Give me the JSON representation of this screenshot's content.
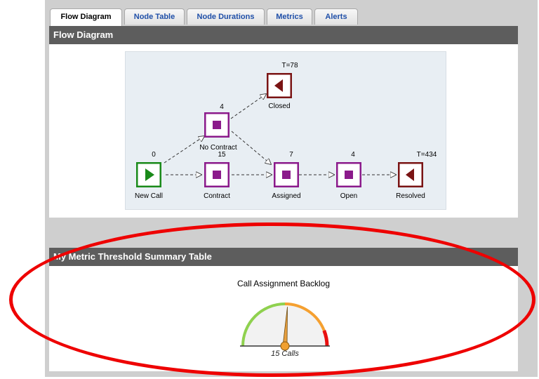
{
  "tabs": [
    {
      "label": "Flow Diagram",
      "active": true
    },
    {
      "label": "Node Table",
      "active": false
    },
    {
      "label": "Node Durations",
      "active": false
    },
    {
      "label": "Metrics",
      "active": false
    },
    {
      "label": "Alerts",
      "active": false
    }
  ],
  "flow_panel": {
    "title": "Flow Diagram",
    "nodes": [
      {
        "name": "New Call",
        "count": "0",
        "icon": "play-icon",
        "color": "#1a8a1a"
      },
      {
        "name": "Contract",
        "count": "15",
        "icon": "stop-icon",
        "color": "#8b1a8b"
      },
      {
        "name": "No Contract",
        "count": "4",
        "icon": "stop-icon",
        "color": "#8b1a8b"
      },
      {
        "name": "Closed",
        "count": "T=78",
        "icon": "back-icon",
        "color": "#7a1414"
      },
      {
        "name": "Assigned",
        "count": "7",
        "icon": "stop-icon",
        "color": "#8b1a8b"
      },
      {
        "name": "Open",
        "count": "4",
        "icon": "stop-icon",
        "color": "#8b1a8b"
      },
      {
        "name": "Resolved",
        "count": "T=434",
        "icon": "back-icon",
        "color": "#7a1414"
      }
    ]
  },
  "metric_panel": {
    "title": "My Metric Threshold Summary Table",
    "gauge": {
      "title": "Call Assignment Backlog",
      "value_label": "15 Calls",
      "value_fraction": 0.52,
      "zones": [
        {
          "name": "normal",
          "color": "#8fd14f"
        },
        {
          "name": "warning",
          "color": "#f5a030"
        },
        {
          "name": "critical",
          "color": "#e81010"
        }
      ]
    }
  },
  "annotation": {
    "color": "#ee0000"
  }
}
